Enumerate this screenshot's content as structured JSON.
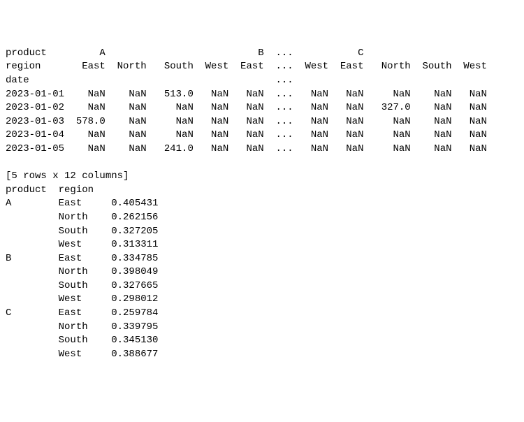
{
  "pivot": {
    "header1": {
      "label": "product",
      "A": "A",
      "B": "B",
      "ellipsis": "...",
      "C": "C"
    },
    "header2": {
      "label": "region",
      "cols": [
        "East",
        "North",
        "South",
        "West",
        "East",
        "...",
        "West",
        "East",
        "North",
        "South",
        "West"
      ]
    },
    "header3": {
      "label": "date",
      "ellipsis": "..."
    },
    "rows": [
      {
        "date": "2023-01-01",
        "cells": [
          "NaN",
          "NaN",
          "513.0",
          "NaN",
          "NaN",
          "...",
          "NaN",
          "NaN",
          "NaN",
          "NaN",
          "NaN"
        ]
      },
      {
        "date": "2023-01-02",
        "cells": [
          "NaN",
          "NaN",
          "NaN",
          "NaN",
          "NaN",
          "...",
          "NaN",
          "NaN",
          "327.0",
          "NaN",
          "NaN"
        ]
      },
      {
        "date": "2023-01-03",
        "cells": [
          "578.0",
          "NaN",
          "NaN",
          "NaN",
          "NaN",
          "...",
          "NaN",
          "NaN",
          "NaN",
          "NaN",
          "NaN"
        ]
      },
      {
        "date": "2023-01-04",
        "cells": [
          "NaN",
          "NaN",
          "NaN",
          "NaN",
          "NaN",
          "...",
          "NaN",
          "NaN",
          "NaN",
          "NaN",
          "NaN"
        ]
      },
      {
        "date": "2023-01-05",
        "cells": [
          "NaN",
          "NaN",
          "241.0",
          "NaN",
          "NaN",
          "...",
          "NaN",
          "NaN",
          "NaN",
          "NaN",
          "NaN"
        ]
      }
    ],
    "shape_note": "[5 rows x 12 columns]"
  },
  "series": {
    "header": {
      "col1": "product",
      "col2": "region"
    },
    "rows": [
      {
        "product": "A",
        "region": "East",
        "value": "0.405431"
      },
      {
        "product": "",
        "region": "North",
        "value": "0.262156"
      },
      {
        "product": "",
        "region": "South",
        "value": "0.327205"
      },
      {
        "product": "",
        "region": "West",
        "value": "0.313311"
      },
      {
        "product": "B",
        "region": "East",
        "value": "0.334785"
      },
      {
        "product": "",
        "region": "North",
        "value": "0.398049"
      },
      {
        "product": "",
        "region": "South",
        "value": "0.327665"
      },
      {
        "product": "",
        "region": "West",
        "value": "0.298012"
      },
      {
        "product": "C",
        "region": "East",
        "value": "0.259784"
      },
      {
        "product": "",
        "region": "North",
        "value": "0.339795"
      },
      {
        "product": "",
        "region": "South",
        "value": "0.345130"
      },
      {
        "product": "",
        "region": "West",
        "value": "0.388677"
      }
    ]
  }
}
